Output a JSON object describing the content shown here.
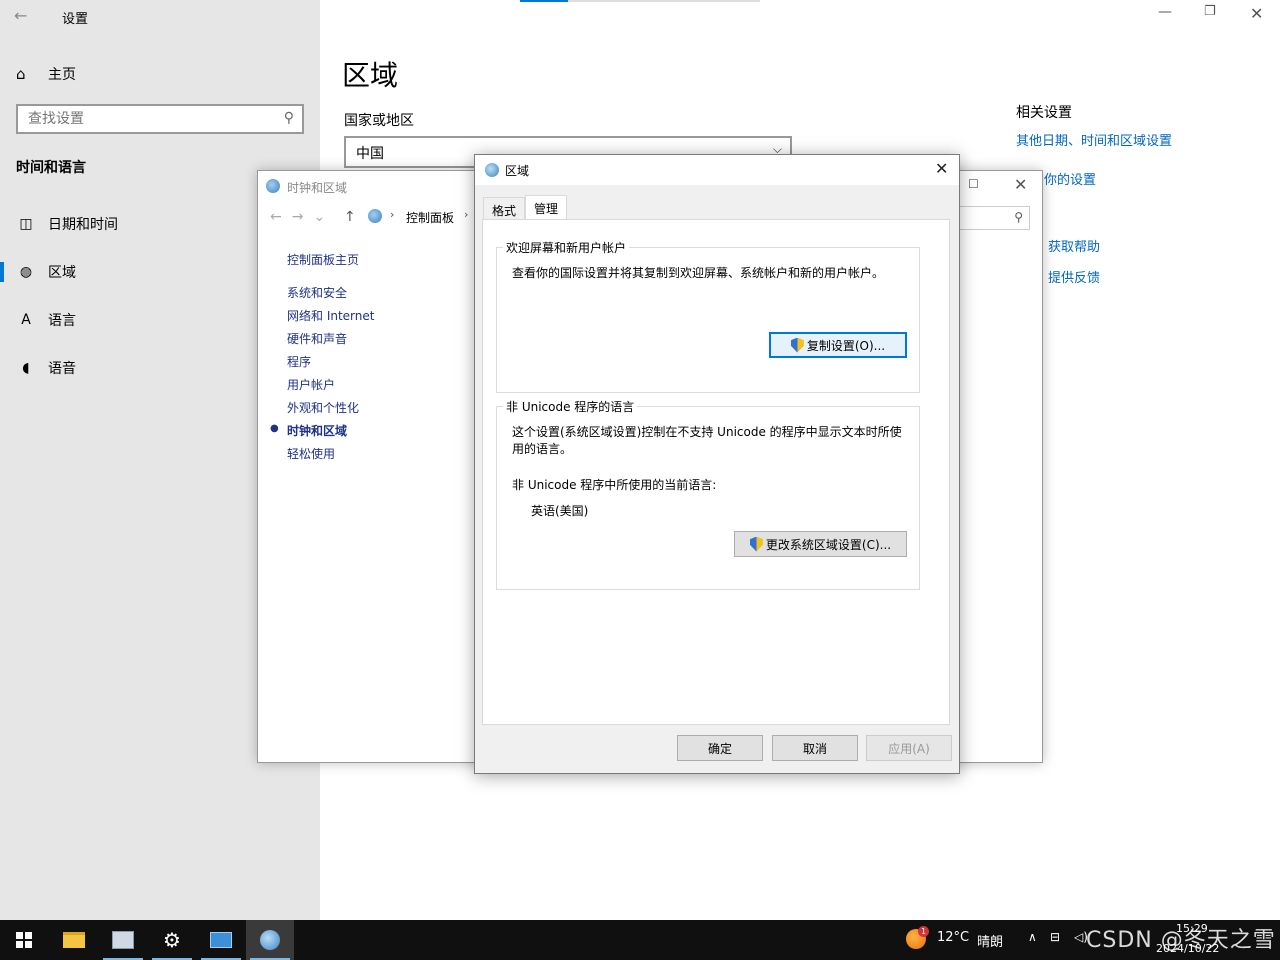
{
  "settings": {
    "title": "设置",
    "home_label": "主页",
    "search_placeholder": "查找设置",
    "section_title": "时间和语言",
    "nav": [
      {
        "label": "日期和时间",
        "icon": "calendar-clock-icon"
      },
      {
        "label": "区域",
        "icon": "globe-icon"
      },
      {
        "label": "语言",
        "icon": "language-icon"
      },
      {
        "label": "语音",
        "icon": "microphone-icon"
      }
    ],
    "page_title": "区域",
    "country_label": "国家或地区",
    "country_value": "中国",
    "related_title": "相关设置",
    "related_links": [
      "其他日期、时间和区域设置",
      "你的设置",
      "获取帮助",
      "提供反馈"
    ]
  },
  "control_panel": {
    "title": "时钟和区域",
    "address": "控制面板",
    "home_link": "控制面板主页",
    "links": [
      "系统和安全",
      "网络和 Internet",
      "硬件和声音",
      "程序",
      "用户帐户",
      "外观和个性化",
      "时钟和区域",
      "轻松使用"
    ],
    "current_link": "时钟和区域"
  },
  "region_dialog": {
    "title": "区域",
    "tabs": [
      "格式",
      "管理"
    ],
    "active_tab": "管理",
    "group1": {
      "legend": "欢迎屏幕和新用户帐户",
      "text": "查看你的国际设置并将其复制到欢迎屏幕、系统帐户和新的用户帐户。",
      "button": "复制设置(O)..."
    },
    "group2": {
      "legend": "非 Unicode 程序的语言",
      "text": "这个设置(系统区域设置)控制在不支持 Unicode 的程序中显示文本时所使用的语言。",
      "current_label": "非 Unicode 程序中所使用的当前语言:",
      "current_value": "英语(美国)",
      "button": "更改系统区域设置(C)..."
    },
    "ok": "确定",
    "cancel": "取消",
    "apply": "应用(A)"
  },
  "taskbar": {
    "apps": [
      "file-explorer-icon",
      "control-panel-icon",
      "settings-gear-icon",
      "control-panel-app-icon",
      "region-icon"
    ],
    "weather_temp": "12°C",
    "weather_text": "晴朗",
    "weather_badge": "1",
    "time": "15:29",
    "date": "2024/10/22",
    "watermark": "CSDN @冬天之雪"
  },
  "colors": {
    "accent": "#0078d7",
    "link": "#0067c0",
    "sidebar_bg": "#e6e6e6",
    "taskbar_bg": "#101010"
  }
}
